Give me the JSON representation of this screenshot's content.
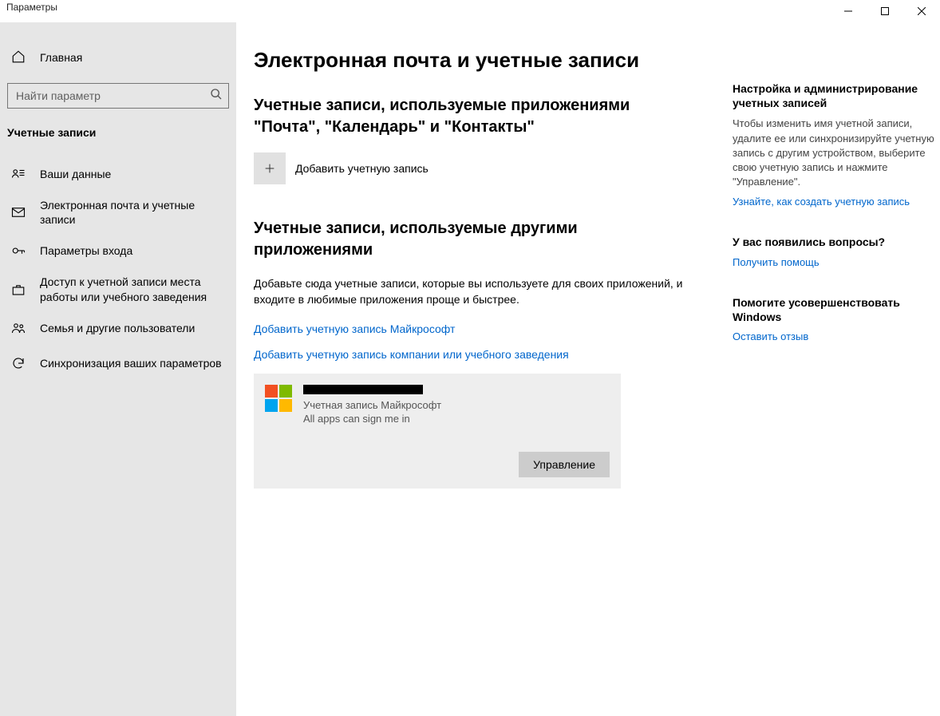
{
  "window": {
    "title": "Параметры"
  },
  "sidebar": {
    "home": "Главная",
    "search_placeholder": "Найти параметр",
    "category": "Учетные записи",
    "items": [
      {
        "label": "Ваши данные"
      },
      {
        "label": "Электронная почта и учетные записи"
      },
      {
        "label": "Параметры входа"
      },
      {
        "label": "Доступ к учетной записи места работы или учебного заведения"
      },
      {
        "label": "Семья и другие пользователи"
      },
      {
        "label": "Синхронизация ваших параметров"
      }
    ]
  },
  "main": {
    "title": "Электронная почта и учетные записи",
    "section1_title": "Учетные записи, используемые приложениями \"Почта\", \"Календарь\" и \"Контакты\"",
    "add_account_label": "Добавить учетную запись",
    "section2_title": "Учетные записи, используемые другими приложениями",
    "section2_desc": "Добавьте сюда учетные записи, которые вы используете для своих приложений, и входите в любимые приложения проще и быстрее.",
    "link_ms": "Добавить учетную запись Майкрософт",
    "link_work": "Добавить учетную запись компании или учебного заведения",
    "account": {
      "type": "Учетная запись Майкрософт",
      "status": "All apps can sign me in",
      "manage_btn": "Управление"
    }
  },
  "help": {
    "block1_title": "Настройка и администрирование учетных записей",
    "block1_text": "Чтобы изменить имя учетной записи, удалите ее или синхронизируйте учетную запись с другим устройством, выберите свою учетную запись и нажмите \"Управление\".",
    "block1_link": "Узнайте, как создать учетную запись",
    "block2_title": "У вас появились вопросы?",
    "block2_link": "Получить помощь",
    "block3_title": "Помогите усовершенствовать Windows",
    "block3_link": "Оставить отзыв"
  },
  "ms_logo_colors": {
    "tl": "#f25022",
    "tr": "#7fba00",
    "bl": "#00a4ef",
    "br": "#ffb900"
  }
}
